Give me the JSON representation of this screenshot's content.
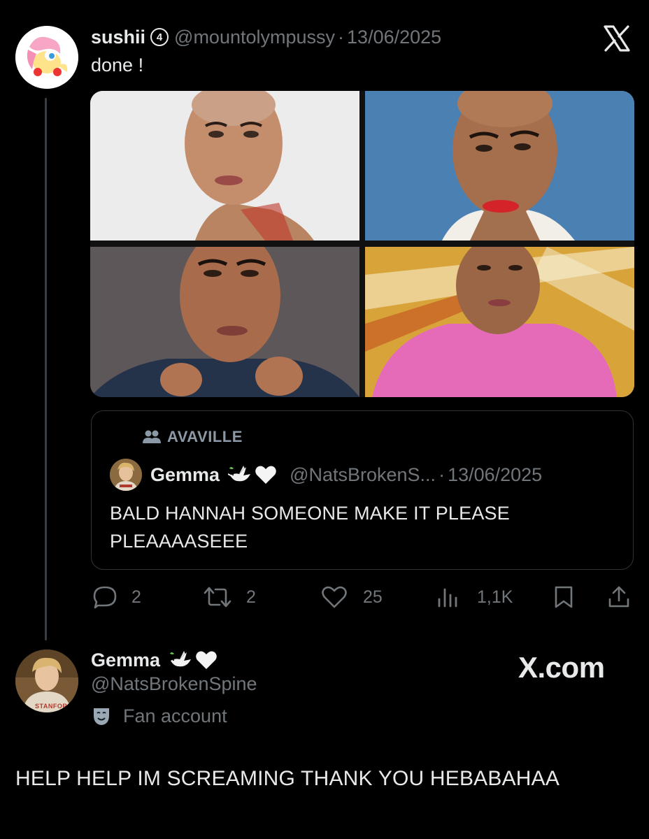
{
  "tweet": {
    "author_name": "sushii",
    "badge": "4",
    "handle": "@mountolympussy",
    "separator": "·",
    "date": "13/06/2025",
    "text": "done !",
    "platform_icon": "x-logo-icon"
  },
  "media": {
    "images": [
      {
        "subject": "bald-woman-red-top-light-background"
      },
      {
        "subject": "bald-woman-white-collar-blue-background"
      },
      {
        "subject": "bald-woman-dark-jacket-grey-background"
      },
      {
        "subject": "bald-woman-pink-top-yellow-background"
      }
    ]
  },
  "quote": {
    "community_icon": "people-icon",
    "community": "AVAVILLE",
    "author_name": "Gemma",
    "author_emoji": [
      "dove-icon",
      "white-heart-icon"
    ],
    "handle": "@NatsBrokenS...",
    "separator": "·",
    "date": "13/06/2025",
    "text": "BALD HANNAH SOMEONE MAKE IT PLEASE PLEAAAASEEE"
  },
  "actions": {
    "replies": "2",
    "reposts": "2",
    "likes": "25",
    "views": "1,1K"
  },
  "reply_user": {
    "name": "Gemma",
    "emoji": [
      "dove-icon",
      "white-heart-icon"
    ],
    "handle": "@NatsBrokenSpine",
    "label_icon": "theater-mask-icon",
    "label": "Fan account",
    "avatar_shirt_text": "STANFORD"
  },
  "watermark": "X.com",
  "reply_text": "HELP HELP IM SCREAMING THANK YOU HEBABAHAA",
  "colors": {
    "background": "#000000",
    "text": "#e7e9ea",
    "muted": "#71767b",
    "border": "#2f3336"
  }
}
